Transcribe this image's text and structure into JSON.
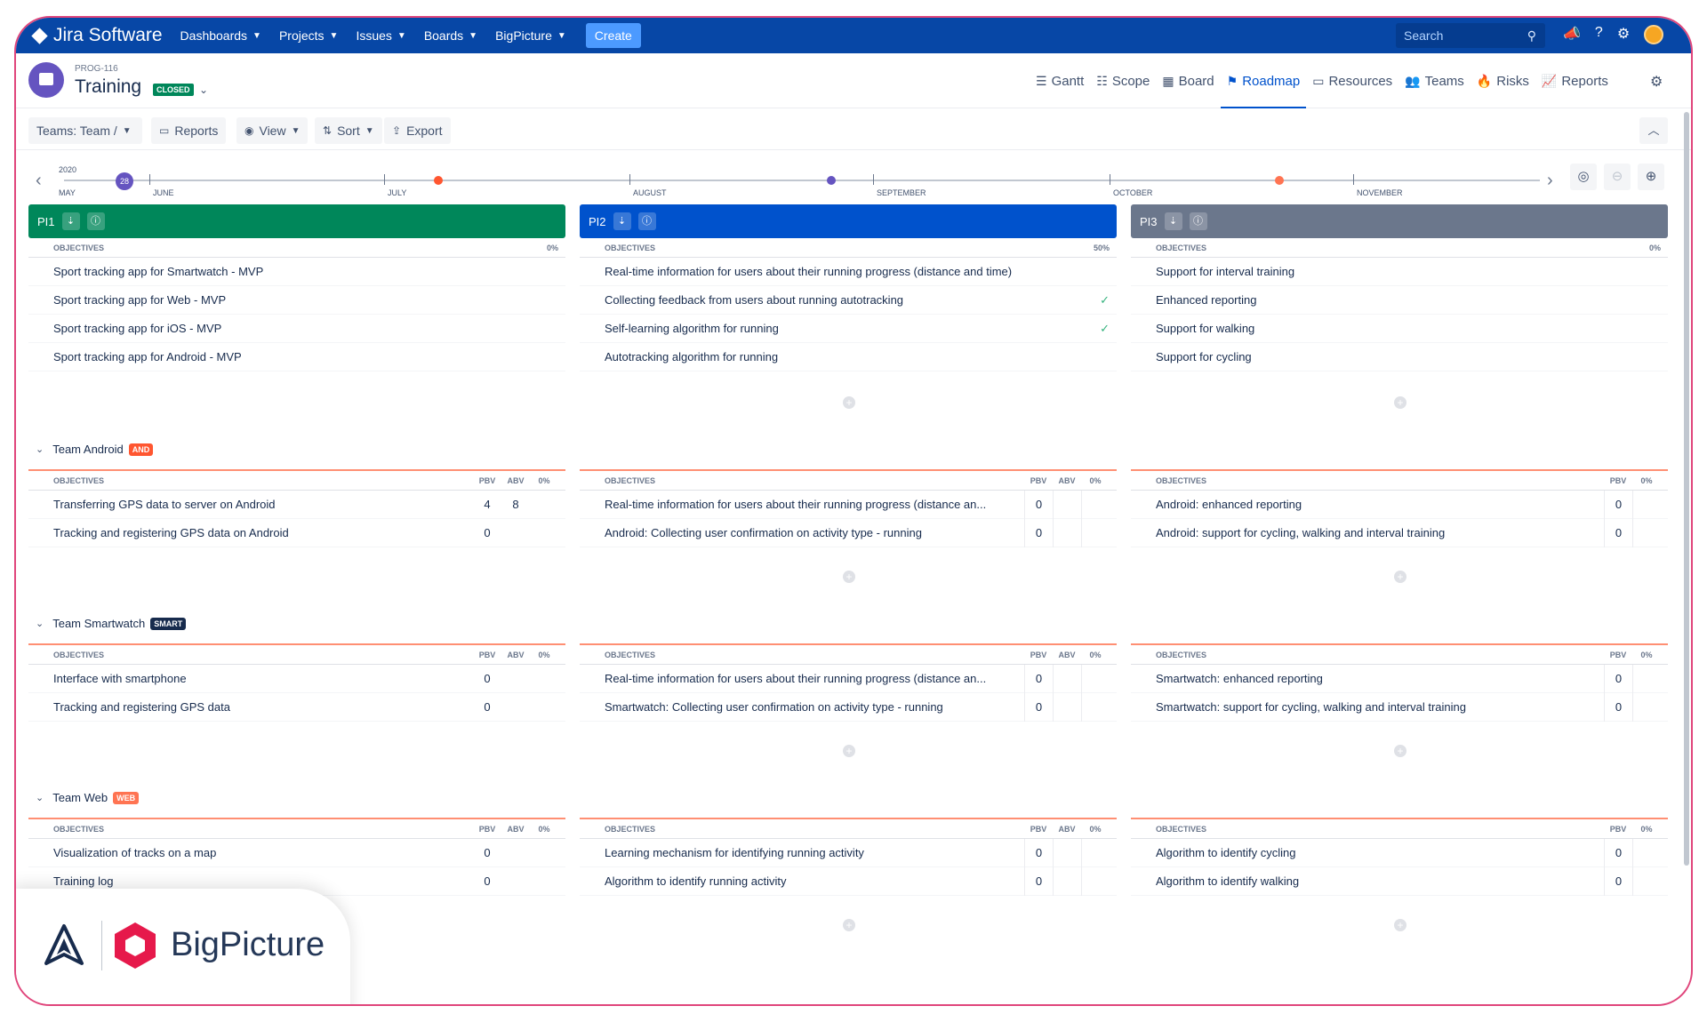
{
  "topnav": {
    "brand": "Jira Software",
    "items": [
      "Dashboards",
      "Projects",
      "Issues",
      "Boards",
      "BigPicture"
    ],
    "create_label": "Create",
    "search_placeholder": "Search"
  },
  "project": {
    "key": "PROG-116",
    "name": "Training",
    "status": "CLOSED"
  },
  "tabs": [
    "Gantt",
    "Scope",
    "Board",
    "Roadmap",
    "Resources",
    "Teams",
    "Risks",
    "Reports"
  ],
  "active_tab": "Roadmap",
  "toolbar": {
    "teams_label": "Teams: Team /",
    "reports_label": "Reports",
    "view_label": "View",
    "sort_label": "Sort",
    "export_label": "Export"
  },
  "timeline": {
    "year": "2020",
    "today": "28",
    "months": [
      "MAY",
      "JUNE",
      "JULY",
      "AUGUST",
      "SEPTEMBER",
      "OCTOBER",
      "NOVEMBER"
    ]
  },
  "colors": {
    "pi1": "#00875a",
    "pi2": "#0052cc",
    "pi3": "#6b778c",
    "badge_and": "#ff5630",
    "badge_smart": "#172b4d",
    "badge_web": "#ff7452"
  },
  "pis": [
    {
      "name": "PI1",
      "objectives_label": "OBJECTIVES",
      "percent": "0%",
      "objectives": [
        {
          "text": "Sport tracking app for Smartwatch - MVP",
          "done": false
        },
        {
          "text": "Sport tracking app for Web - MVP",
          "done": false
        },
        {
          "text": "Sport tracking app for iOS - MVP",
          "done": false
        },
        {
          "text": "Sport tracking app for Android - MVP",
          "done": false
        }
      ]
    },
    {
      "name": "PI2",
      "objectives_label": "OBJECTIVES",
      "percent": "50%",
      "objectives": [
        {
          "text": "Real-time information for users about their running progress (distance and time)",
          "done": false
        },
        {
          "text": "Collecting feedback from users about running autotracking",
          "done": true
        },
        {
          "text": "Self-learning algorithm for running",
          "done": true
        },
        {
          "text": "Autotracking algorithm for running",
          "done": false
        }
      ]
    },
    {
      "name": "PI3",
      "objectives_label": "OBJECTIVES",
      "percent": "0%",
      "objectives": [
        {
          "text": "Support for interval training",
          "done": false
        },
        {
          "text": "Enhanced reporting",
          "done": false
        },
        {
          "text": "Support for walking",
          "done": false
        },
        {
          "text": "Support for cycling",
          "done": false
        }
      ]
    }
  ],
  "table_headers": {
    "objectives": "OBJECTIVES",
    "pbv": "PBV",
    "abv": "ABV",
    "pct": "0%"
  },
  "teams": [
    {
      "name": "Team Android",
      "badge": "AND",
      "columns": [
        {
          "rows": [
            {
              "text": "Transferring GPS data to server on Android",
              "pbv": "4",
              "abv": "8"
            },
            {
              "text": "Tracking and registering GPS data on Android",
              "pbv": "0",
              "abv": ""
            }
          ]
        },
        {
          "rows": [
            {
              "text": "Real-time information for users about their running progress (distance an...",
              "pbv": "0",
              "abv": ""
            },
            {
              "text": "Android: Collecting user confirmation on activity type - running",
              "pbv": "0",
              "abv": ""
            }
          ]
        },
        {
          "rows": [
            {
              "text": "Android: enhanced reporting",
              "pbv": "0"
            },
            {
              "text": "Android: support for cycling, walking and interval training",
              "pbv": "0"
            }
          ]
        }
      ]
    },
    {
      "name": "Team Smartwatch",
      "badge": "SMART",
      "columns": [
        {
          "rows": [
            {
              "text": "Interface with smartphone",
              "pbv": "0",
              "abv": ""
            },
            {
              "text": "Tracking and registering GPS data",
              "pbv": "0",
              "abv": ""
            }
          ]
        },
        {
          "rows": [
            {
              "text": "Real-time information for users about their running progress (distance an...",
              "pbv": "0",
              "abv": ""
            },
            {
              "text": "Smartwatch: Collecting user confirmation on activity type - running",
              "pbv": "0",
              "abv": ""
            }
          ]
        },
        {
          "rows": [
            {
              "text": "Smartwatch: enhanced reporting",
              "pbv": "0"
            },
            {
              "text": "Smartwatch: support for cycling, walking and interval training",
              "pbv": "0"
            }
          ]
        }
      ]
    },
    {
      "name": "Team Web",
      "badge": "WEB",
      "columns": [
        {
          "rows": [
            {
              "text": "Visualization of tracks on a map",
              "pbv": "0",
              "abv": ""
            },
            {
              "text": "Training log",
              "pbv": "0",
              "abv": ""
            }
          ]
        },
        {
          "rows": [
            {
              "text": "Learning mechanism for identifying running activity",
              "pbv": "0",
              "abv": ""
            },
            {
              "text": "Algorithm to identify running activity",
              "pbv": "0",
              "abv": ""
            }
          ]
        },
        {
          "rows": [
            {
              "text": "Algorithm to identify cycling",
              "pbv": "0"
            },
            {
              "text": "Algorithm to identify walking",
              "pbv": "0"
            }
          ]
        }
      ]
    }
  ],
  "logo": {
    "text": "BigPicture"
  }
}
